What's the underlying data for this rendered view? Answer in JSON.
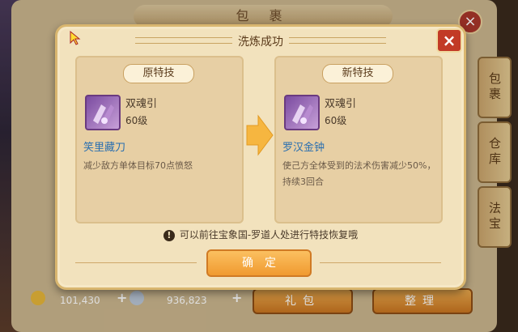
{
  "background": {
    "title": "包  裹",
    "side_tabs": [
      "包裹",
      "仓库",
      "法宝"
    ],
    "gold": "101,430",
    "silver": "936,823",
    "gift_button": "礼包",
    "sort_button": "整理"
  },
  "dialog": {
    "title": "洗炼成功",
    "close_symbol": "×",
    "original": {
      "header": "原特技",
      "item_name": "双魂引",
      "item_level": "60级",
      "skill_name": "笑里藏刀",
      "skill_desc": "减少敌方单体目标70点愤怒"
    },
    "new": {
      "header": "新特技",
      "item_name": "双魂引",
      "item_level": "60级",
      "skill_name": "罗汉金钟",
      "skill_desc": "使己方全体受到的法术伤害减少50%，持续3回合"
    },
    "notice_icon": "!",
    "notice": "可以前往宝象国-罗道人处进行特技恢复哦",
    "confirm_label": "确定"
  },
  "colors": {
    "skill_blue": "#2a6fb0",
    "accent_orange": "#f09a30",
    "close_red": "#c23a26"
  }
}
